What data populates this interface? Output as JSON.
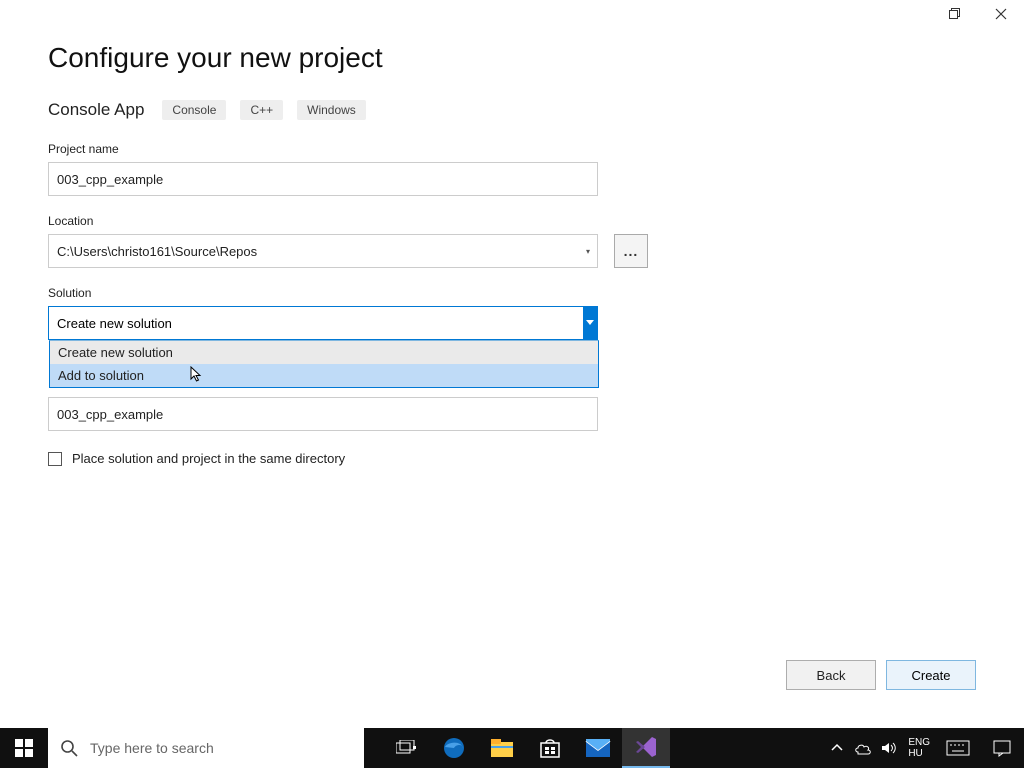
{
  "window": {
    "title": "Configure your new project",
    "subtitle": "Console App",
    "tags": [
      "Console",
      "C++",
      "Windows"
    ]
  },
  "fields": {
    "project_name_label": "Project name",
    "project_name_value": "003_cpp_example",
    "location_label": "Location",
    "location_value": "C:\\Users\\christo161\\Source\\Repos",
    "browse_ellipsis": "...",
    "solution_label": "Solution",
    "solution_value": "Create new solution",
    "solution_options": [
      "Create new solution",
      "Add to solution"
    ],
    "solution_option_hover_index": 1,
    "solution_name_value": "003_cpp_example",
    "same_dir_checkbox_label": "Place solution and project in the same directory",
    "same_dir_checked": false
  },
  "footer": {
    "back": "Back",
    "create": "Create"
  },
  "taskbar": {
    "search_placeholder": "Type here to search",
    "lang_top": "ENG",
    "lang_bottom": "HU"
  }
}
